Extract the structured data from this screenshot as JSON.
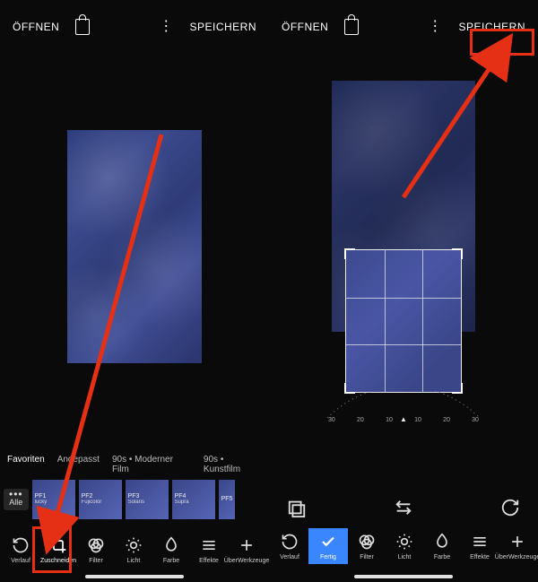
{
  "left": {
    "topbar": {
      "open": "ÖFFNEN",
      "save": "SPEICHERN"
    },
    "preset_tabs": [
      "Favoriten",
      "Angepasst",
      "90s • Moderner Film",
      "90s • Kunstfilm"
    ],
    "alle_label": "Alle",
    "thumbs": [
      {
        "code": "PF1",
        "name": "lucky"
      },
      {
        "code": "PF2",
        "name": "Fujicolor"
      },
      {
        "code": "PF3",
        "name": "Solaris"
      },
      {
        "code": "PF4",
        "name": "Supra"
      },
      {
        "code": "PF5",
        "name": ""
      }
    ],
    "tools": [
      "Verlauf",
      "Zuschneiden",
      "Filter",
      "Licht",
      "Farbe",
      "Effekte",
      "ÜberWerkzeuge"
    ]
  },
  "right": {
    "topbar": {
      "open": "ÖFFNEN",
      "save": "SPEICHERN"
    },
    "dial": {
      "labels": [
        "30",
        "20",
        "10",
        "10",
        "20",
        "30"
      ],
      "center_tri": "▲"
    },
    "tools": [
      "Verlauf",
      "Fertig",
      "Filter",
      "Licht",
      "Farbe",
      "Effekte",
      "ÜberWerkzeuge"
    ]
  }
}
